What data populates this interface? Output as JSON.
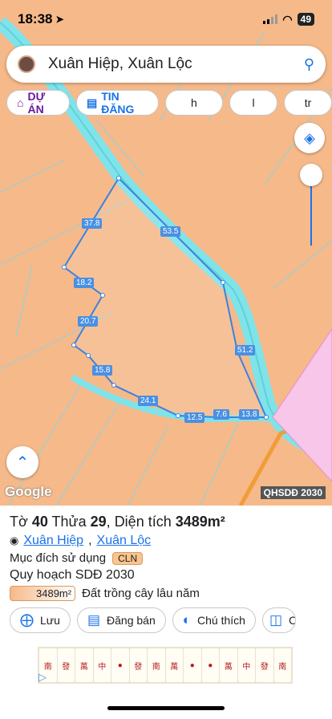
{
  "status": {
    "time": "18:38",
    "battery": "49"
  },
  "search": {
    "query": "Xuân Hiệp, Xuân Lộc"
  },
  "chips": [
    {
      "label": "DỰ ÁN",
      "icon": "house-icon"
    },
    {
      "label": "TIN ĐĂNG",
      "icon": "list-icon"
    },
    {
      "label": "h"
    },
    {
      "label": "l"
    },
    {
      "label": "tr"
    }
  ],
  "map": {
    "segment_labels": [
      "37.8",
      "53.5",
      "18.2",
      "20.7",
      "15.8",
      "51.2",
      "24.1",
      "12.5",
      "7.6",
      "13.8"
    ],
    "watermark": "Google",
    "overlay_label": "QHSDĐ 2030"
  },
  "parcel": {
    "to_label": "Tờ",
    "to_value": "40",
    "thua_label": "Thửa",
    "thua_value": "29",
    "area_label": "Diện tích",
    "area_value": "3489m²",
    "ward": "Xuân Hiệp",
    "district": "Xuân Lộc",
    "purpose_label": "Mục đích sử dụng",
    "purpose_code": "CLN",
    "plan_label": "Quy hoạch SDĐ 2030",
    "plan_area": "3489m²",
    "plan_desc": "Đất trồng cây lâu năm"
  },
  "actions": [
    {
      "label": "Lưu",
      "icon": "add-doc-icon"
    },
    {
      "label": "Đăng bán",
      "icon": "listing-icon"
    },
    {
      "label": "Chú thích",
      "icon": "contrast-icon"
    },
    {
      "label": "Ch",
      "icon": "camera-icon"
    }
  ],
  "ad": {
    "tiles": [
      "南",
      "發",
      "萬",
      "中",
      "●",
      "發",
      "南",
      "萬",
      "●",
      "●",
      "萬",
      "中",
      "發",
      "南"
    ]
  }
}
